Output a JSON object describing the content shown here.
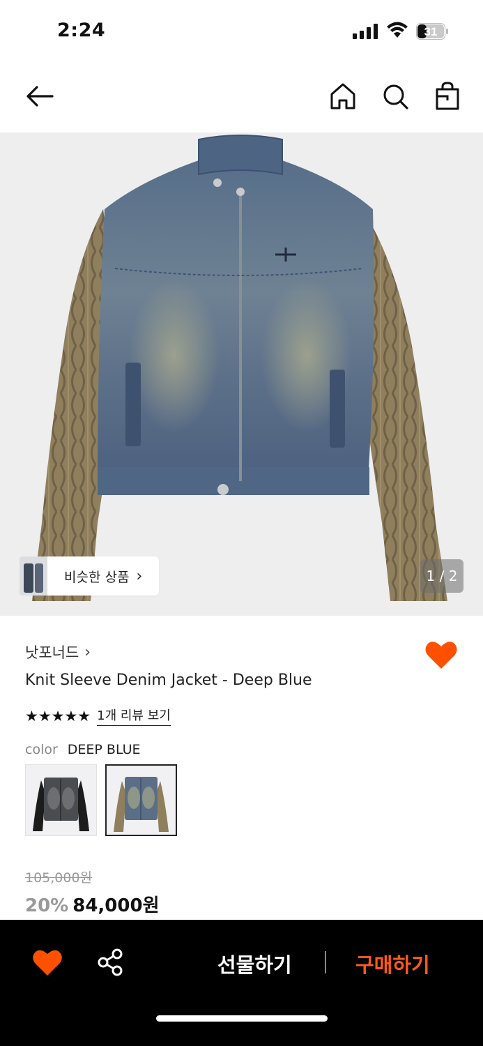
{
  "status_bar": {
    "time": "2:24",
    "battery": "31"
  },
  "nav": {
    "icons": [
      "back-arrow-icon",
      "home-icon",
      "search-icon",
      "shopping-bag-icon"
    ]
  },
  "hero": {
    "similar_label": "비슷한 상품",
    "similar_chevron": "›",
    "counter": "1 / 2"
  },
  "product": {
    "brand": "낫포너드",
    "brand_chevron": "›",
    "title": "Knit Sleeve Denim Jacket - Deep Blue",
    "stars": "★★★★★",
    "review_link": "1개 리뷰 보기",
    "color_label": "color",
    "color_value": "DEEP BLUE",
    "original_price": "105,000원",
    "discount": "20%",
    "price": "84,000원"
  },
  "bottom_bar": {
    "gift": "선물하기",
    "buy": "구매하기"
  },
  "colors": {
    "accent": "#ff5a1f",
    "heart": "#ff5000",
    "bottom_bar_bg": "#000000"
  }
}
